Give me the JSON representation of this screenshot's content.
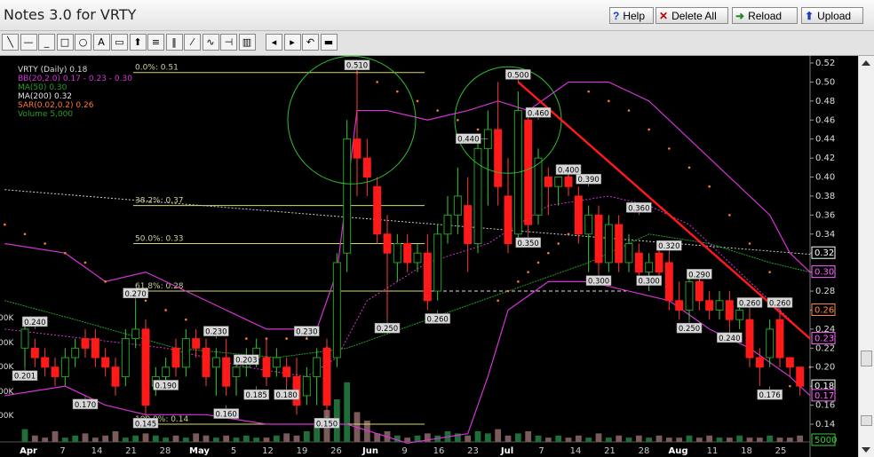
{
  "window": {
    "title": "Notes 3.0 for VRTY",
    "buttons": [
      {
        "icon": "help-icon",
        "glyph": "?",
        "label": "Help",
        "color": "#1a3fb8"
      },
      {
        "icon": "close-x-icon",
        "glyph": "✕",
        "label": "Delete All",
        "color": "#c00000"
      },
      {
        "icon": "reload-arrow-icon",
        "glyph": "➜",
        "label": "Reload",
        "color": "#1f8a1f"
      },
      {
        "icon": "upload-icon",
        "glyph": "⬆",
        "label": "Upload",
        "color": "#1a3fb8"
      }
    ]
  },
  "toolbar": {
    "tools": [
      {
        "icon": "diagonal-line-icon",
        "glyph": "╲"
      },
      {
        "icon": "horizontal-line-icon",
        "glyph": "—"
      },
      {
        "icon": "underline-icon",
        "glyph": "_"
      },
      {
        "icon": "rectangle-icon",
        "glyph": "□"
      },
      {
        "icon": "ellipse-icon",
        "glyph": "○"
      },
      {
        "icon": "text-icon",
        "glyph": "A"
      },
      {
        "icon": "callout-icon",
        "glyph": "▭"
      },
      {
        "icon": "arrow-up-icon",
        "glyph": "⬆"
      },
      {
        "icon": "horizontal-lines-icon",
        "glyph": "≡"
      },
      {
        "icon": "vertical-lines-icon",
        "glyph": "‖"
      },
      {
        "icon": "fibonacci-icon",
        "glyph": "⁄"
      },
      {
        "icon": "trendline-chart-icon",
        "glyph": "∿"
      },
      {
        "icon": "level-line-icon",
        "glyph": "⊣"
      },
      {
        "icon": "channel-icon",
        "glyph": "▥"
      },
      {
        "icon": "move-left-icon",
        "glyph": "◂"
      },
      {
        "icon": "move-right-icon",
        "glyph": "▸"
      },
      {
        "icon": "undo-icon",
        "glyph": "↶"
      },
      {
        "icon": "color-swatch-icon",
        "glyph": "▬"
      }
    ]
  },
  "chart_data": {
    "type": "candlestick",
    "symbol": "VRTY",
    "legend": [
      {
        "text": "VRTY (Daily) 0.18",
        "color": "#dddddd"
      },
      {
        "text": "BB(20,2.0) 0.17 - 0.23 - 0.30",
        "color": "#d633d6"
      },
      {
        "text": "MA(50) 0.30",
        "color": "#23a023"
      },
      {
        "text": "MA(200) 0.32",
        "color": "#e6e6e6"
      },
      {
        "text": "SAR(0.02,0.2) 0.26",
        "color": "#ff7a33"
      },
      {
        "text": "Volume 5,000",
        "color": "#23a023"
      }
    ],
    "ylim": [
      0.14,
      0.52
    ],
    "yticks": [
      "0.52",
      "0.50",
      "0.48",
      "0.46",
      "0.44",
      "0.42",
      "0.40",
      "0.38",
      "0.36",
      "0.34",
      "0.32",
      "0.30",
      "0.28",
      "0.26",
      "0.24",
      "0.22",
      "0.20",
      "0.18",
      "0.16",
      "0.14"
    ],
    "xticks": [
      "Apr",
      "7",
      "14",
      "21",
      "28",
      "May",
      "5",
      "12",
      "19",
      "26",
      "Jun",
      "9",
      "16",
      "23",
      "Jul",
      "7",
      "14",
      "21",
      "28",
      "Aug",
      "11",
      "18",
      "25"
    ],
    "left_ticks": [
      "00K",
      "00K",
      "00K",
      "00K",
      "00K"
    ],
    "right_labels": [
      {
        "value": "0.32",
        "bg": "#000000",
        "color": "#ffffff",
        "y": 0.32
      },
      {
        "value": "0.30",
        "bg": "#000000",
        "color": "#ff66ff",
        "y": 0.3
      },
      {
        "value": "0.26",
        "bg": "#000000",
        "color": "#ff8844",
        "y": 0.26
      },
      {
        "value": "0.23",
        "bg": "#000000",
        "color": "#ff66ff",
        "y": 0.23
      },
      {
        "value": "0.18",
        "bg": "#000000",
        "color": "#ffffff",
        "y": 0.18
      },
      {
        "value": "0.17",
        "bg": "#000000",
        "color": "#ff66ff",
        "y": 0.17
      },
      {
        "value": "5000",
        "bg": "#000000",
        "color": "#33cc33",
        "y": 0.14
      }
    ],
    "fib_levels": [
      {
        "label": "0.0%: 0.51",
        "value": 0.51
      },
      {
        "label": "38.2%: 0.37",
        "value": 0.37
      },
      {
        "label": "50.0%: 0.33",
        "value": 0.33
      },
      {
        "label": "61.8%: 0.28",
        "value": 0.28
      },
      {
        "label": "100.0%: 0.14",
        "value": 0.14
      }
    ],
    "candles": [
      {
        "o": 0.22,
        "h": 0.25,
        "l": 0.2,
        "c": 0.24
      },
      {
        "o": 0.22,
        "h": 0.23,
        "l": 0.2,
        "c": 0.21
      },
      {
        "o": 0.21,
        "h": 0.22,
        "l": 0.19,
        "c": 0.2
      },
      {
        "o": 0.2,
        "h": 0.21,
        "l": 0.18,
        "c": 0.19
      },
      {
        "o": 0.19,
        "h": 0.22,
        "l": 0.18,
        "c": 0.21
      },
      {
        "o": 0.21,
        "h": 0.23,
        "l": 0.2,
        "c": 0.22
      },
      {
        "o": 0.23,
        "h": 0.24,
        "l": 0.21,
        "c": 0.22
      },
      {
        "o": 0.23,
        "h": 0.24,
        "l": 0.2,
        "c": 0.21
      },
      {
        "o": 0.21,
        "h": 0.22,
        "l": 0.19,
        "c": 0.2
      },
      {
        "o": 0.2,
        "h": 0.21,
        "l": 0.17,
        "c": 0.18
      },
      {
        "o": 0.19,
        "h": 0.24,
        "l": 0.18,
        "c": 0.23
      },
      {
        "o": 0.23,
        "h": 0.27,
        "l": 0.22,
        "c": 0.24
      },
      {
        "o": 0.24,
        "h": 0.25,
        "l": 0.15,
        "c": 0.16
      },
      {
        "o": 0.18,
        "h": 0.2,
        "l": 0.17,
        "c": 0.19
      },
      {
        "o": 0.19,
        "h": 0.21,
        "l": 0.18,
        "c": 0.2
      },
      {
        "o": 0.22,
        "h": 0.23,
        "l": 0.19,
        "c": 0.2
      },
      {
        "o": 0.2,
        "h": 0.24,
        "l": 0.19,
        "c": 0.23
      },
      {
        "o": 0.23,
        "h": 0.24,
        "l": 0.21,
        "c": 0.22
      },
      {
        "o": 0.22,
        "h": 0.23,
        "l": 0.18,
        "c": 0.19
      },
      {
        "o": 0.2,
        "h": 0.22,
        "l": 0.17,
        "c": 0.21
      },
      {
        "o": 0.21,
        "h": 0.23,
        "l": 0.17,
        "c": 0.18
      },
      {
        "o": 0.19,
        "h": 0.21,
        "l": 0.17,
        "c": 0.2
      },
      {
        "o": 0.2,
        "h": 0.22,
        "l": 0.19,
        "c": 0.21
      },
      {
        "o": 0.21,
        "h": 0.23,
        "l": 0.2,
        "c": 0.22
      },
      {
        "o": 0.21,
        "h": 0.23,
        "l": 0.18,
        "c": 0.19
      },
      {
        "o": 0.2,
        "h": 0.22,
        "l": 0.19,
        "c": 0.21
      },
      {
        "o": 0.2,
        "h": 0.21,
        "l": 0.18,
        "c": 0.19
      },
      {
        "o": 0.19,
        "h": 0.21,
        "l": 0.15,
        "c": 0.16
      },
      {
        "o": 0.17,
        "h": 0.2,
        "l": 0.16,
        "c": 0.19
      },
      {
        "o": 0.19,
        "h": 0.22,
        "l": 0.16,
        "c": 0.21
      },
      {
        "o": 0.22,
        "h": 0.23,
        "l": 0.15,
        "c": 0.16
      },
      {
        "o": 0.21,
        "h": 0.32,
        "l": 0.2,
        "c": 0.31
      },
      {
        "o": 0.32,
        "h": 0.46,
        "l": 0.3,
        "c": 0.44
      },
      {
        "o": 0.44,
        "h": 0.51,
        "l": 0.38,
        "c": 0.42
      },
      {
        "o": 0.42,
        "h": 0.44,
        "l": 0.38,
        "c": 0.4
      },
      {
        "o": 0.39,
        "h": 0.4,
        "l": 0.33,
        "c": 0.34
      },
      {
        "o": 0.34,
        "h": 0.36,
        "l": 0.25,
        "c": 0.32
      },
      {
        "o": 0.31,
        "h": 0.34,
        "l": 0.29,
        "c": 0.33
      },
      {
        "o": 0.33,
        "h": 0.34,
        "l": 0.3,
        "c": 0.31
      },
      {
        "o": 0.31,
        "h": 0.33,
        "l": 0.3,
        "c": 0.32
      },
      {
        "o": 0.32,
        "h": 0.34,
        "l": 0.26,
        "c": 0.27
      },
      {
        "o": 0.28,
        "h": 0.35,
        "l": 0.27,
        "c": 0.34
      },
      {
        "o": 0.34,
        "h": 0.38,
        "l": 0.33,
        "c": 0.36
      },
      {
        "o": 0.36,
        "h": 0.41,
        "l": 0.34,
        "c": 0.38
      },
      {
        "o": 0.37,
        "h": 0.4,
        "l": 0.3,
        "c": 0.33
      },
      {
        "o": 0.33,
        "h": 0.44,
        "l": 0.32,
        "c": 0.43
      },
      {
        "o": 0.43,
        "h": 0.47,
        "l": 0.37,
        "c": 0.45
      },
      {
        "o": 0.45,
        "h": 0.5,
        "l": 0.37,
        "c": 0.39
      },
      {
        "o": 0.38,
        "h": 0.42,
        "l": 0.32,
        "c": 0.33
      },
      {
        "o": 0.34,
        "h": 0.49,
        "l": 0.33,
        "c": 0.47
      },
      {
        "o": 0.46,
        "h": 0.47,
        "l": 0.34,
        "c": 0.35
      },
      {
        "o": 0.36,
        "h": 0.43,
        "l": 0.35,
        "c": 0.42
      },
      {
        "o": 0.4,
        "h": 0.41,
        "l": 0.36,
        "c": 0.39
      },
      {
        "o": 0.39,
        "h": 0.4,
        "l": 0.37,
        "c": 0.4
      },
      {
        "o": 0.4,
        "h": 0.41,
        "l": 0.38,
        "c": 0.39
      },
      {
        "o": 0.38,
        "h": 0.39,
        "l": 0.33,
        "c": 0.34
      },
      {
        "o": 0.34,
        "h": 0.37,
        "l": 0.3,
        "c": 0.36
      },
      {
        "o": 0.36,
        "h": 0.37,
        "l": 0.3,
        "c": 0.31
      },
      {
        "o": 0.31,
        "h": 0.36,
        "l": 0.3,
        "c": 0.35
      },
      {
        "o": 0.35,
        "h": 0.36,
        "l": 0.3,
        "c": 0.31
      },
      {
        "o": 0.31,
        "h": 0.34,
        "l": 0.3,
        "c": 0.33
      },
      {
        "o": 0.32,
        "h": 0.33,
        "l": 0.29,
        "c": 0.3
      },
      {
        "o": 0.3,
        "h": 0.32,
        "l": 0.28,
        "c": 0.31
      },
      {
        "o": 0.32,
        "h": 0.33,
        "l": 0.29,
        "c": 0.3
      },
      {
        "o": 0.31,
        "h": 0.32,
        "l": 0.26,
        "c": 0.27
      },
      {
        "o": 0.27,
        "h": 0.29,
        "l": 0.25,
        "c": 0.26
      },
      {
        "o": 0.26,
        "h": 0.3,
        "l": 0.25,
        "c": 0.29
      },
      {
        "o": 0.29,
        "h": 0.3,
        "l": 0.26,
        "c": 0.27
      },
      {
        "o": 0.27,
        "h": 0.28,
        "l": 0.25,
        "c": 0.26
      },
      {
        "o": 0.26,
        "h": 0.28,
        "l": 0.25,
        "c": 0.27
      },
      {
        "o": 0.27,
        "h": 0.28,
        "l": 0.24,
        "c": 0.25
      },
      {
        "o": 0.25,
        "h": 0.27,
        "l": 0.24,
        "c": 0.26
      },
      {
        "o": 0.25,
        "h": 0.26,
        "l": 0.2,
        "c": 0.21
      },
      {
        "o": 0.21,
        "h": 0.22,
        "l": 0.18,
        "c": 0.2
      },
      {
        "o": 0.21,
        "h": 0.25,
        "l": 0.2,
        "c": 0.24
      },
      {
        "o": 0.25,
        "h": 0.26,
        "l": 0.2,
        "c": 0.21
      },
      {
        "o": 0.21,
        "h": 0.21,
        "l": 0.19,
        "c": 0.2
      },
      {
        "o": 0.2,
        "h": 0.2,
        "l": 0.17,
        "c": 0.18
      }
    ],
    "volumes": [
      6,
      3,
      2,
      5,
      2,
      3,
      4,
      2,
      3,
      5,
      2,
      3,
      4,
      3,
      2,
      3,
      2,
      4,
      3,
      2,
      3,
      2,
      3,
      2,
      2,
      3,
      4,
      3,
      5,
      8,
      15,
      20,
      28,
      14,
      10,
      4,
      5,
      3,
      2,
      3,
      4,
      3,
      5,
      4,
      3,
      5,
      4,
      6,
      3,
      4,
      5,
      3,
      2,
      3,
      2,
      3,
      2,
      4,
      2,
      3,
      2,
      3,
      2,
      3,
      2,
      2,
      3,
      2,
      3,
      2,
      2,
      3,
      2,
      2,
      3,
      2,
      2,
      3
    ],
    "price_labels": [
      {
        "text": "0.240",
        "i": 1,
        "v": 0.24,
        "pos": "above"
      },
      {
        "text": "0.201",
        "i": 0,
        "v": 0.2,
        "pos": "below"
      },
      {
        "text": "0.170",
        "i": 6,
        "v": 0.17,
        "pos": "below"
      },
      {
        "text": "0.270",
        "i": 11,
        "v": 0.27,
        "pos": "above"
      },
      {
        "text": "0.145",
        "i": 12,
        "v": 0.15,
        "pos": "below"
      },
      {
        "text": "0.190",
        "i": 14,
        "v": 0.19,
        "pos": "below"
      },
      {
        "text": "0.230",
        "i": 19,
        "v": 0.23,
        "pos": "above"
      },
      {
        "text": "0.160",
        "i": 20,
        "v": 0.16,
        "pos": "below"
      },
      {
        "text": "0.203",
        "i": 22,
        "v": 0.2,
        "pos": "above"
      },
      {
        "text": "0.185",
        "i": 23,
        "v": 0.18,
        "pos": "below"
      },
      {
        "text": "0.180",
        "i": 26,
        "v": 0.18,
        "pos": "below"
      },
      {
        "text": "0.230",
        "i": 28,
        "v": 0.23,
        "pos": "above"
      },
      {
        "text": "0.150",
        "i": 30,
        "v": 0.15,
        "pos": "below"
      },
      {
        "text": "0.510",
        "i": 33,
        "v": 0.51,
        "pos": "above"
      },
      {
        "text": "0.250",
        "i": 36,
        "v": 0.25,
        "pos": "below"
      },
      {
        "text": "0.260",
        "i": 41,
        "v": 0.26,
        "pos": "below"
      },
      {
        "text": "0.440",
        "i": 46,
        "v": 0.44,
        "pos": "left"
      },
      {
        "text": "0.500",
        "i": 49,
        "v": 0.5,
        "pos": "above"
      },
      {
        "text": "0.350",
        "i": 50,
        "v": 0.34,
        "pos": "below"
      },
      {
        "text": "0.460",
        "i": 51,
        "v": 0.46,
        "pos": "above"
      },
      {
        "text": "0.400",
        "i": 54,
        "v": 0.4,
        "pos": "above"
      },
      {
        "text": "0.390",
        "i": 56,
        "v": 0.39,
        "pos": "above"
      },
      {
        "text": "0.300",
        "i": 57,
        "v": 0.3,
        "pos": "below"
      },
      {
        "text": "0.360",
        "i": 61,
        "v": 0.36,
        "pos": "above"
      },
      {
        "text": "0.300",
        "i": 62,
        "v": 0.3,
        "pos": "below"
      },
      {
        "text": "0.320",
        "i": 64,
        "v": 0.32,
        "pos": "above"
      },
      {
        "text": "0.290",
        "i": 67,
        "v": 0.29,
        "pos": "above"
      },
      {
        "text": "0.250",
        "i": 66,
        "v": 0.25,
        "pos": "below"
      },
      {
        "text": "0.240",
        "i": 70,
        "v": 0.24,
        "pos": "below"
      },
      {
        "text": "0.260",
        "i": 72,
        "v": 0.26,
        "pos": "above"
      },
      {
        "text": "0.176",
        "i": 74,
        "v": 0.18,
        "pos": "below"
      },
      {
        "text": "0.260",
        "i": 75,
        "v": 0.26,
        "pos": "above"
      }
    ],
    "grid": false,
    "background": "#000000",
    "up_color": "#23a023",
    "down_color": "#ff1a1a"
  }
}
